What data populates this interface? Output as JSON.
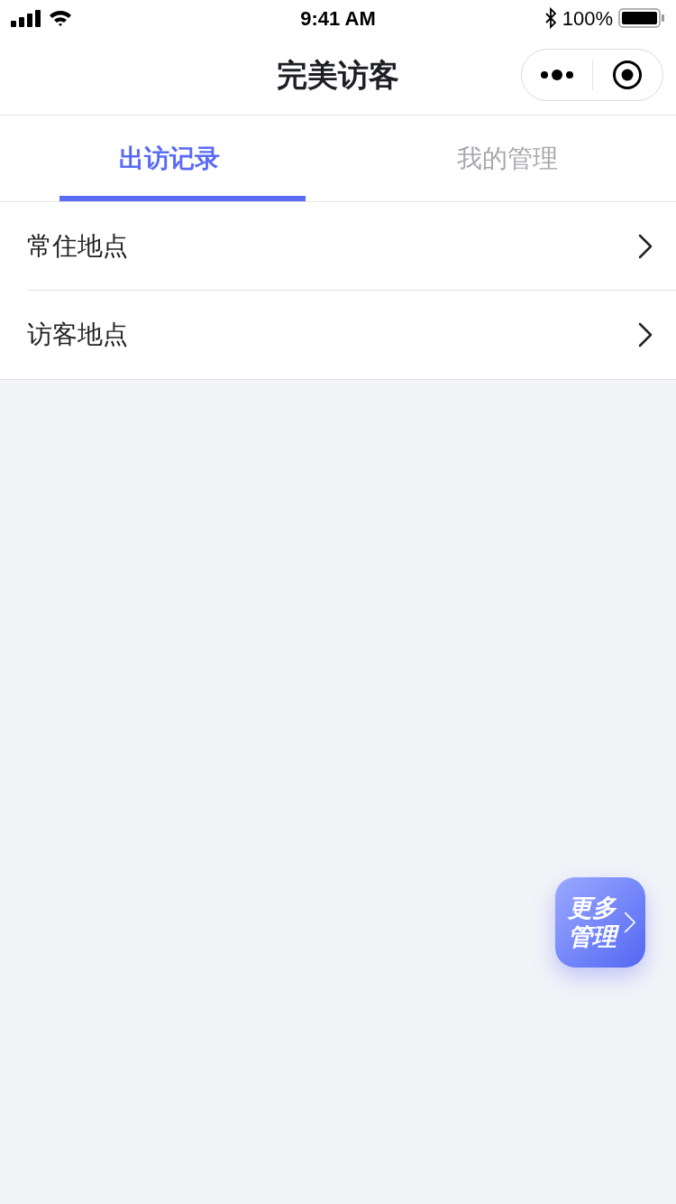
{
  "status_bar": {
    "time": "9:41 AM",
    "battery": "100%"
  },
  "nav": {
    "title": "完美访客"
  },
  "tabs": [
    {
      "label": "出访记录",
      "selected": true
    },
    {
      "label": "我的管理",
      "selected": false
    }
  ],
  "list": [
    {
      "label": "常住地点"
    },
    {
      "label": "访客地点"
    }
  ],
  "floating_button": {
    "label": "更多管理"
  }
}
